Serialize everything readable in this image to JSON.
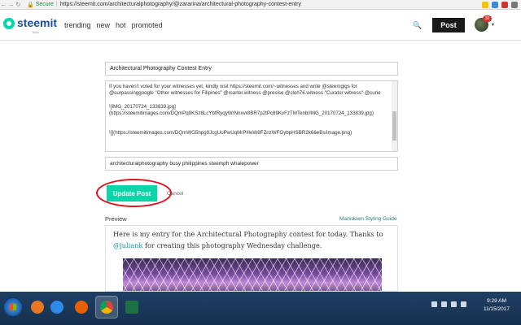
{
  "browser": {
    "secure_label": "Secure",
    "url": "https://steemit.com/architecturalphotography/@zararina/architectural-photography-contest-entry"
  },
  "header": {
    "logo_text": "steemit",
    "logo_badge": "beta",
    "nav": [
      "trending",
      "new",
      "hot",
      "promoted"
    ],
    "post_label": "Post",
    "notification_count": "30"
  },
  "editor": {
    "title_value": "Architectural Photography Contest Entry",
    "body_value": "If you haven't voted for your witnesses yet, kindly visit https://steemit.com/~witnesses and write @steemgigs for @surpassinggoogle \"Other witnesses for Filipinos\" @rcarter.witness @precise @cloh76.witness \"Curator witness\" @curie\n\n![IMG_20170724_133839.jpg](https://steemitimages.com/DQmPq9KSz8LcYbfRyqyWrNnxvr8BR7p2tPc89KvFzTMTenb/IMG_20170724_133839.jpg)\n\n\n![](https://steemitimages.com/DQmWG5hpg9JcgUoPwUqMrPHeW8FZnzWFGybpHSBR2k66eBs/image.png)",
    "tags_value": "architecturalphotography busy philippines steemph whalepower",
    "update_label": "Update Post",
    "cancel_label": "Cancel"
  },
  "preview": {
    "label": "Preview",
    "markdown_link": "Markdown Styling Guide",
    "text_before": "Here is my entry for the Architectural Photography contest for today. Thanks to ",
    "mention": "@juliank",
    "text_after": " for creating this photography Wednesday challenge."
  },
  "taskbar": {
    "time": "9:29 AM",
    "date": "11/15/2017"
  },
  "colors": {
    "accent": "#06d6a9",
    "brand_blue": "#1a5099",
    "highlight_ring": "#e0101a",
    "taskbar": "#1f3f66"
  }
}
